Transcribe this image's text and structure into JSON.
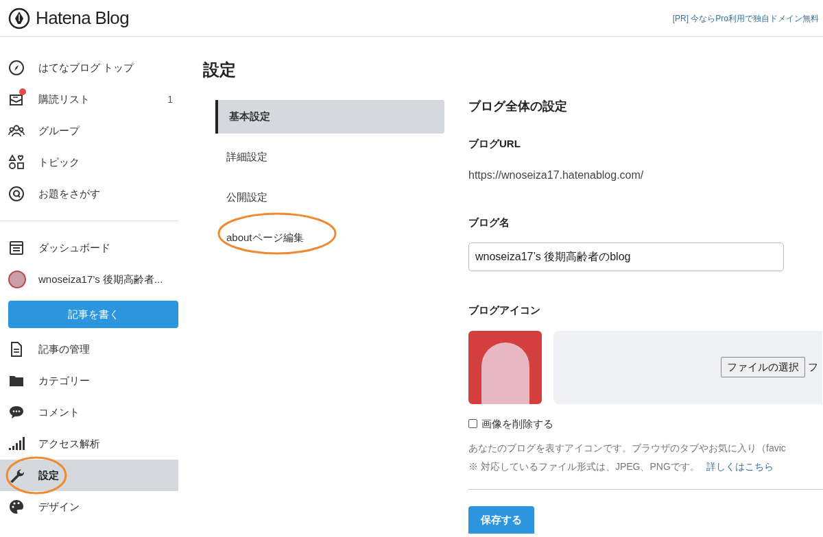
{
  "header": {
    "logo": "Hatena Blog",
    "ad": "[PR] 今ならPro利用で独自ドメイン無料"
  },
  "sidebar": {
    "groups": [
      {
        "items": [
          {
            "kind": "compass",
            "label": "はてなブログ トップ",
            "selected": false
          },
          {
            "kind": "mail",
            "label": "購読リスト",
            "count": "1",
            "notification": true,
            "selected": false
          },
          {
            "kind": "group",
            "label": "グループ",
            "selected": false
          },
          {
            "kind": "topic",
            "label": "トピック",
            "selected": false
          },
          {
            "kind": "question",
            "label": "お題をさがす",
            "selected": false
          }
        ]
      },
      {
        "items": [
          {
            "kind": "dashboard",
            "label": "ダッシュボード",
            "selected": false
          },
          {
            "kind": "avatar",
            "label": "wnoseiza17’s 後期高齢者...",
            "selected": false
          },
          {
            "kind": "button",
            "label": "記事を書く"
          },
          {
            "kind": "document",
            "label": "記事の管理",
            "selected": false
          },
          {
            "kind": "folder",
            "label": "カテゴリー",
            "selected": false
          },
          {
            "kind": "comment",
            "label": "コメント",
            "selected": false
          },
          {
            "kind": "chart",
            "label": "アクセス解析",
            "selected": false
          },
          {
            "kind": "wrench",
            "label": "設定",
            "selected": true,
            "annotated": true
          },
          {
            "kind": "palette",
            "label": "デザイン",
            "selected": false
          }
        ]
      }
    ]
  },
  "page_title": "設定",
  "settings_nav": [
    {
      "label": "基本設定",
      "selected": true,
      "annotated": false
    },
    {
      "label": "詳細設定",
      "selected": false,
      "annotated": false
    },
    {
      "label": "公開設定",
      "selected": false,
      "annotated": false
    },
    {
      "label": "aboutページ編集",
      "selected": false,
      "annotated": true
    }
  ],
  "content": {
    "heading": "ブログ全体の設定",
    "url_label": "ブログURL",
    "url": "https://wnoseiza17.hatenablog.com/",
    "name_label": "ブログ名",
    "name_value": "wnoseiza17’s 後期高齢者のblog",
    "icon_label": "ブログアイコン",
    "file_button": "ファイルの選択",
    "file_status": "フ",
    "delete_checkbox": {
      "label": "画像を削除する",
      "checked": false
    },
    "description": "あなたのブログを表すアイコンです。ブラウザのタブやお気に入り（favic",
    "note": "※ 対応しているファイル形式は、JPEG、PNGです。",
    "note_link": "詳しくはこちら",
    "save_button": "保存する"
  }
}
